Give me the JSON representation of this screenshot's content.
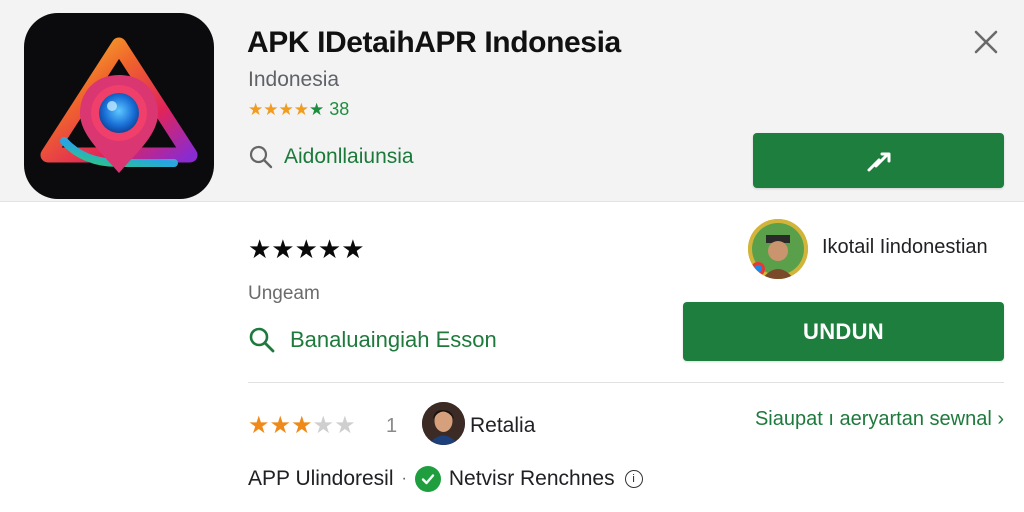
{
  "header": {
    "title": "APK IDetaihAPR Indonesia",
    "developer": "Indonesia",
    "rating_stars": 5,
    "rating_count": "38",
    "search_label": "Aidonllaiunsia",
    "install_icon": "hammer-icon",
    "close_icon": "close-icon"
  },
  "main": {
    "stars_big": "★★★★★",
    "subtitle": "Ungeam",
    "search_label": "Banaluaingiah Esson",
    "developer_name": "Ikotail Iindonestian",
    "primary_button": "UNDUN"
  },
  "review": {
    "rating": 3.5,
    "rating_num": "1",
    "reviewer_name": "Retalia",
    "see_more": "Siaupat ı aeryartan sewnal ›"
  },
  "footer": {
    "app_label": "APP Ulindoresil",
    "separator": "·",
    "status_label": "Netvisr Renchnes",
    "info_icon": "ⓘ"
  },
  "colors": {
    "accent_green": "#1e7e3e",
    "star_orange": "#f29c1f",
    "header_bg": "#f3f3f4"
  }
}
